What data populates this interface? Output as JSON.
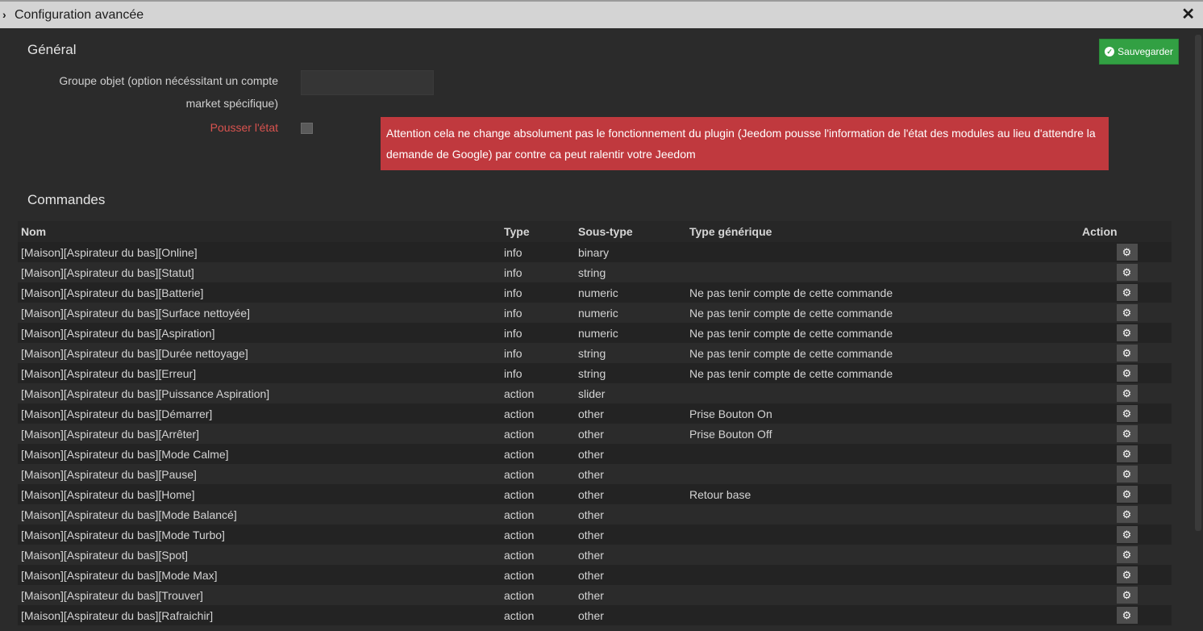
{
  "window": {
    "title": "Configuration avancée"
  },
  "general": {
    "title": "Général",
    "save_label": "Sauvegarder",
    "group_label_line1": "Groupe objet (option nécéssitant un compte",
    "group_label_line2": "market spécifique)",
    "group_value": "",
    "push_label": "Pousser l'état",
    "push_checked": false,
    "alert": "Attention cela ne change absolument pas le fonctionnement du plugin (Jeedom pousse l'information de l'état des modules au lieu d'attendre la demande de Google) par contre ca peut ralentir votre Jeedom"
  },
  "commands": {
    "title": "Commandes",
    "headers": {
      "name": "Nom",
      "type": "Type",
      "subtype": "Sous-type",
      "generic": "Type générique",
      "action": "Action"
    },
    "rows": [
      {
        "name": "[Maison][Aspirateur du bas][Online]",
        "type": "info",
        "subtype": "binary",
        "generic": ""
      },
      {
        "name": "[Maison][Aspirateur du bas][Statut]",
        "type": "info",
        "subtype": "string",
        "generic": ""
      },
      {
        "name": "[Maison][Aspirateur du bas][Batterie]",
        "type": "info",
        "subtype": "numeric",
        "generic": "Ne pas tenir compte de cette commande"
      },
      {
        "name": "[Maison][Aspirateur du bas][Surface nettoyée]",
        "type": "info",
        "subtype": "numeric",
        "generic": "Ne pas tenir compte de cette commande"
      },
      {
        "name": "[Maison][Aspirateur du bas][Aspiration]",
        "type": "info",
        "subtype": "numeric",
        "generic": "Ne pas tenir compte de cette commande"
      },
      {
        "name": "[Maison][Aspirateur du bas][Durée nettoyage]",
        "type": "info",
        "subtype": "string",
        "generic": "Ne pas tenir compte de cette commande"
      },
      {
        "name": "[Maison][Aspirateur du bas][Erreur]",
        "type": "info",
        "subtype": "string",
        "generic": "Ne pas tenir compte de cette commande"
      },
      {
        "name": "[Maison][Aspirateur du bas][Puissance Aspiration]",
        "type": "action",
        "subtype": "slider",
        "generic": ""
      },
      {
        "name": "[Maison][Aspirateur du bas][Démarrer]",
        "type": "action",
        "subtype": "other",
        "generic": "Prise Bouton On"
      },
      {
        "name": "[Maison][Aspirateur du bas][Arrêter]",
        "type": "action",
        "subtype": "other",
        "generic": "Prise Bouton Off"
      },
      {
        "name": "[Maison][Aspirateur du bas][Mode Calme]",
        "type": "action",
        "subtype": "other",
        "generic": ""
      },
      {
        "name": "[Maison][Aspirateur du bas][Pause]",
        "type": "action",
        "subtype": "other",
        "generic": ""
      },
      {
        "name": "[Maison][Aspirateur du bas][Home]",
        "type": "action",
        "subtype": "other",
        "generic": "Retour base"
      },
      {
        "name": "[Maison][Aspirateur du bas][Mode Balancé]",
        "type": "action",
        "subtype": "other",
        "generic": ""
      },
      {
        "name": "[Maison][Aspirateur du bas][Mode Turbo]",
        "type": "action",
        "subtype": "other",
        "generic": ""
      },
      {
        "name": "[Maison][Aspirateur du bas][Spot]",
        "type": "action",
        "subtype": "other",
        "generic": ""
      },
      {
        "name": "[Maison][Aspirateur du bas][Mode Max]",
        "type": "action",
        "subtype": "other",
        "generic": ""
      },
      {
        "name": "[Maison][Aspirateur du bas][Trouver]",
        "type": "action",
        "subtype": "other",
        "generic": ""
      },
      {
        "name": "[Maison][Aspirateur du bas][Rafraichir]",
        "type": "action",
        "subtype": "other",
        "generic": ""
      }
    ]
  },
  "icons": {
    "title_chevron": "chevron-right-icon",
    "close": "close-icon",
    "save": "check-circle-icon",
    "row_action": "gears-icon"
  },
  "colors": {
    "save": "#32a043",
    "alert": "#c0393e",
    "push_label": "#d9534f"
  }
}
